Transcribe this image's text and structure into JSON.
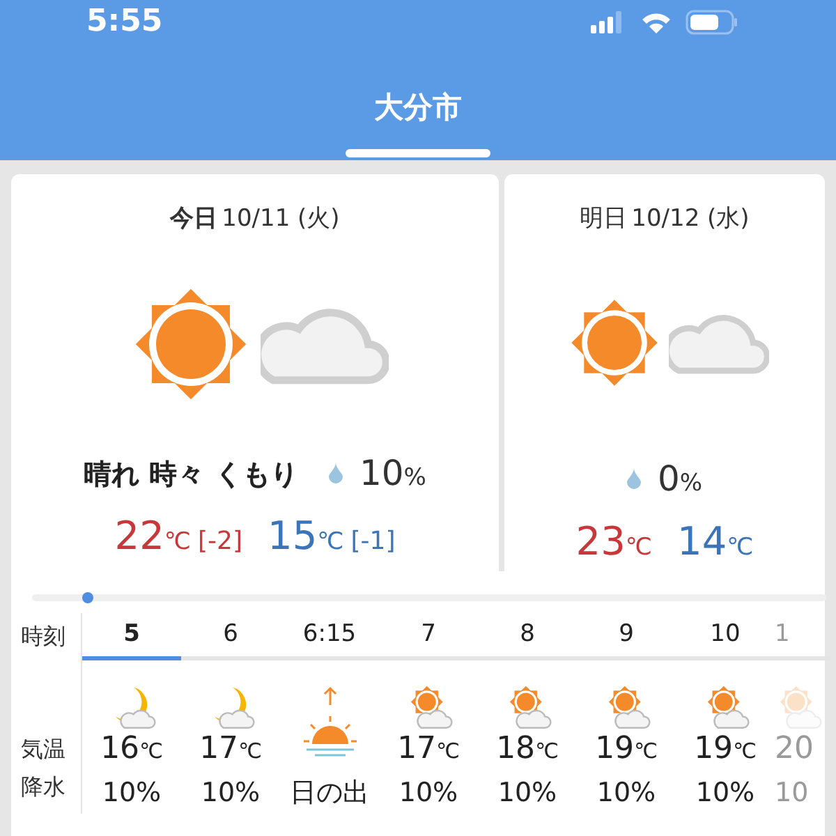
{
  "status_bar": {
    "time": "5:55"
  },
  "header": {
    "title": "大分市"
  },
  "days": [
    {
      "label": "今日",
      "date": "10/11 (火)",
      "selected": true,
      "weather": "晴れ 時々 くもり",
      "precip": "10",
      "precip_unit": "%",
      "high": "22",
      "high_unit": "℃",
      "high_diff": "[-2]",
      "low": "15",
      "low_unit": "℃",
      "low_diff": "[-1]"
    },
    {
      "label": "明日",
      "date": "10/12 (水)",
      "selected": false,
      "precip": "0",
      "precip_unit": "%",
      "high": "23",
      "high_unit": "℃",
      "low": "14",
      "low_unit": "℃"
    }
  ],
  "hourly": {
    "row_labels": [
      "時刻",
      "気温",
      "降水"
    ],
    "hours": [
      {
        "time": "5",
        "selected": true,
        "kind": "moon",
        "temp": "16",
        "unit": "℃",
        "rain": "10%"
      },
      {
        "time": "6",
        "selected": false,
        "kind": "moon",
        "temp": "17",
        "unit": "℃",
        "rain": "10%"
      },
      {
        "time": "6:15",
        "selected": false,
        "kind": "sunrise",
        "rain": "日の出"
      },
      {
        "time": "7",
        "selected": false,
        "kind": "sun",
        "temp": "17",
        "unit": "℃",
        "rain": "10%"
      },
      {
        "time": "8",
        "selected": false,
        "kind": "sun",
        "temp": "18",
        "unit": "℃",
        "rain": "10%"
      },
      {
        "time": "9",
        "selected": false,
        "kind": "sun",
        "temp": "19",
        "unit": "℃",
        "rain": "10%"
      },
      {
        "time": "10",
        "selected": false,
        "kind": "sun",
        "temp": "19",
        "unit": "℃",
        "rain": "10%"
      },
      {
        "time": "1",
        "selected": false,
        "kind": "faded",
        "temp": "20",
        "rain": "10"
      }
    ]
  }
}
